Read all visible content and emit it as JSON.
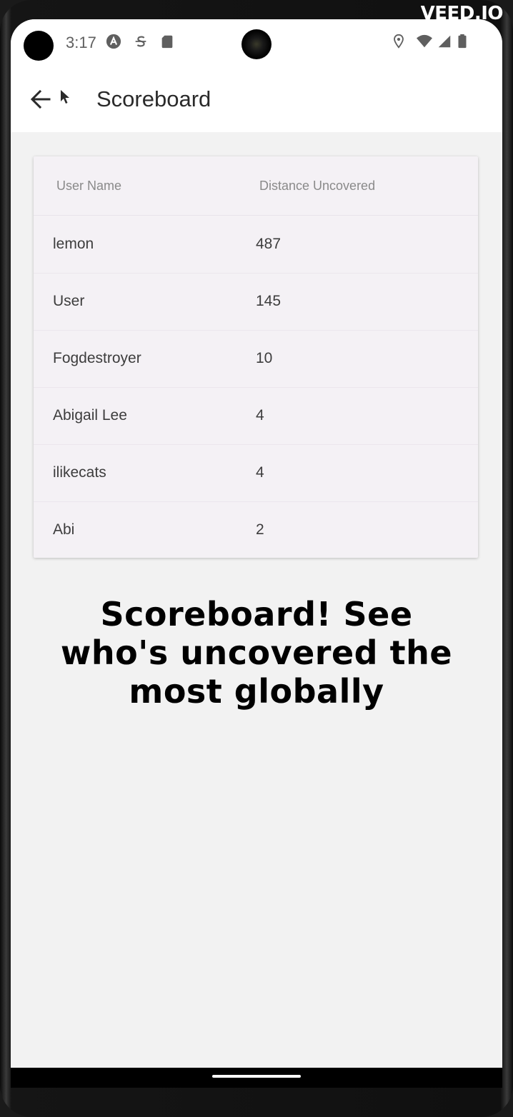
{
  "watermark": "VEED.IO",
  "status_bar": {
    "time": "3:17",
    "icons": [
      "a-badge-icon",
      "s-sync-icon",
      "sd-card-icon",
      "location-icon",
      "wifi-icon",
      "cell-signal-icon",
      "battery-icon"
    ]
  },
  "app_bar": {
    "title": "Scoreboard",
    "back_icon": "arrow-left-icon"
  },
  "scoreboard": {
    "columns": [
      "User Name",
      "Distance Uncovered"
    ],
    "rows": [
      {
        "user": "lemon",
        "distance": "487"
      },
      {
        "user": "User",
        "distance": "145"
      },
      {
        "user": "Fogdestroyer",
        "distance": "10"
      },
      {
        "user": "Abigail Lee",
        "distance": "4"
      },
      {
        "user": "ilikecats",
        "distance": "4"
      },
      {
        "user": "Abi",
        "distance": "2"
      }
    ]
  },
  "caption": {
    "line1": "Scoreboard! See",
    "line2": "who's uncovered the",
    "line3": "most globally"
  },
  "colors": {
    "screen_bg": "#f2f2f2",
    "card_bg": "#f4f1f5",
    "appbar_bg": "#ffffff",
    "text_primary": "#2a2a2a"
  }
}
